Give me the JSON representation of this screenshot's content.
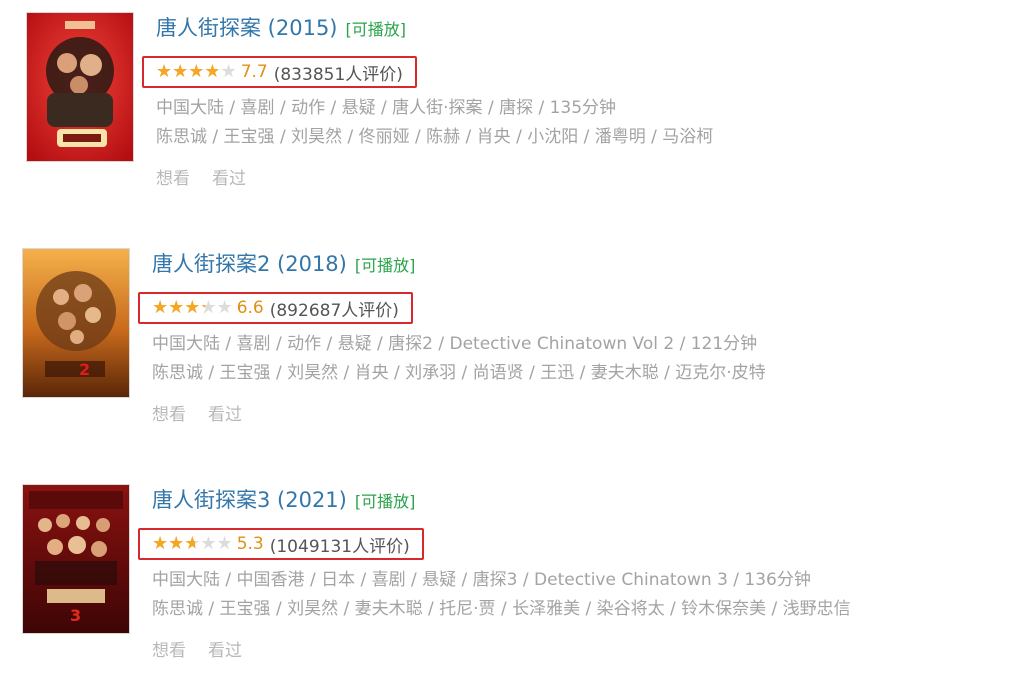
{
  "movies": [
    {
      "title": "唐人街探案 (2015)",
      "playable_label": "[可播放]",
      "rating": 7.7,
      "score": "7.7",
      "votes": "(833851人评价)",
      "meta": "中国大陆 / 喜剧 / 动作 / 悬疑 / 唐人街·探案 / 唐探 / 135分钟",
      "cast": "陈思诚 / 王宝强 / 刘昊然 / 佟丽娅 / 陈赫 / 肖央 / 小沈阳 / 潘粤明 / 马浴柯",
      "want": "想看",
      "seen": "看过"
    },
    {
      "title": "唐人街探案2 (2018)",
      "playable_label": "[可播放]",
      "rating": 6.6,
      "score": "6.6",
      "votes": "(892687人评价)",
      "meta": "中国大陆 / 喜剧 / 动作 / 悬疑 / 唐探2 / Detective Chinatown Vol 2 / 121分钟",
      "cast": "陈思诚 / 王宝强 / 刘昊然 / 肖央 / 刘承羽 / 尚语贤 / 王迅 / 妻夫木聪 / 迈克尔·皮特",
      "want": "想看",
      "seen": "看过"
    },
    {
      "title": "唐人街探案3 (2021)",
      "playable_label": "[可播放]",
      "rating": 5.3,
      "score": "5.3",
      "votes": "(1049131人评价)",
      "meta": "中国大陆 / 中国香港 / 日本 / 喜剧 / 悬疑 / 唐探3 / Detective Chinatown 3 / 136分钟",
      "cast": "陈思诚 / 王宝强 / 刘昊然 / 妻夫木聪 / 托尼·贾 / 长泽雅美 / 染谷将太 / 铃木保奈美 / 浅野忠信",
      "want": "想看",
      "seen": "看过"
    }
  ],
  "colors": {
    "title": "#3377aa",
    "playable": "#2aa34a",
    "highlight_border": "#d7282e",
    "star": "#f5a623",
    "score": "#e09015"
  }
}
